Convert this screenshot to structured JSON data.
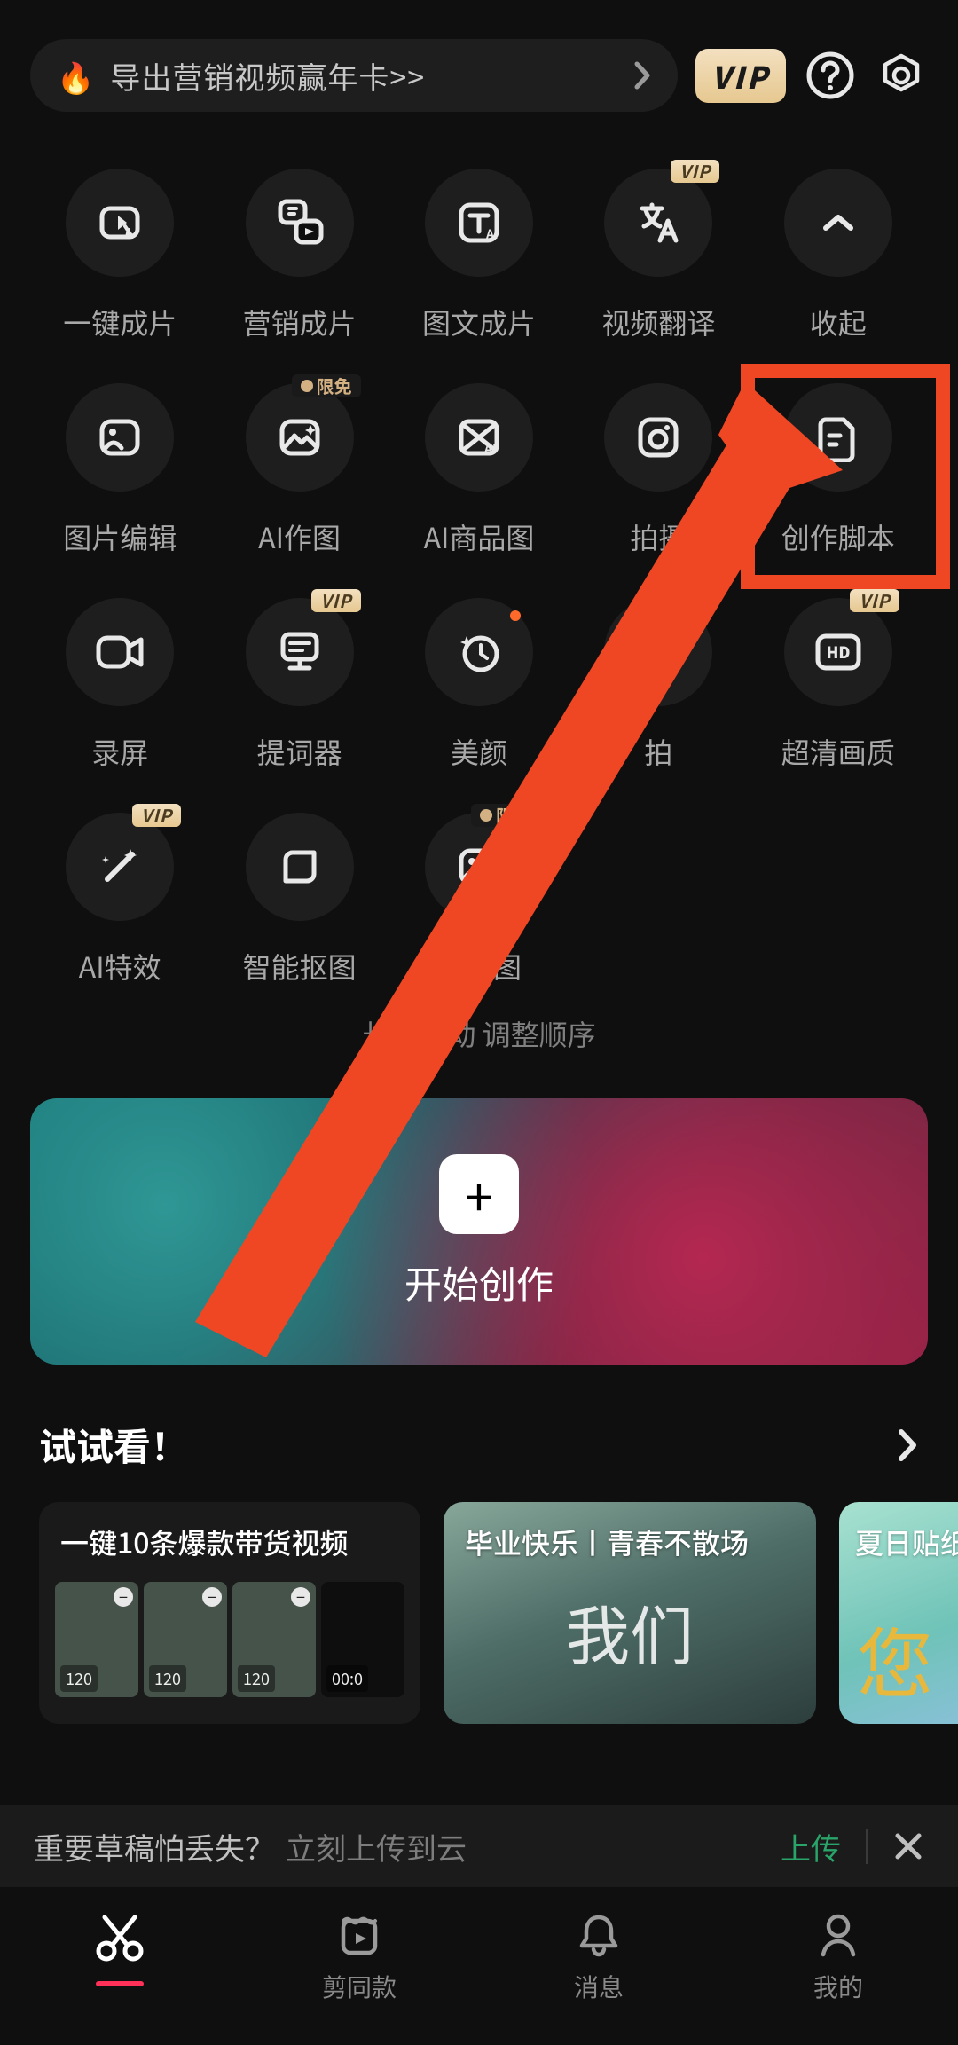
{
  "top": {
    "promo_text": "导出营销视频赢年卡>>",
    "vip_label": "VIP"
  },
  "tags": {
    "vip": "VIP",
    "limited": "限免"
  },
  "grid": {
    "row1": [
      {
        "label": "一键成片"
      },
      {
        "label": "营销成片"
      },
      {
        "label": "图文成片"
      },
      {
        "label": "视频翻译"
      },
      {
        "label": "收起"
      }
    ],
    "row2": [
      {
        "label": "图片编辑"
      },
      {
        "label": "AI作图"
      },
      {
        "label": "AI商品图"
      },
      {
        "label": "拍摄"
      },
      {
        "label": "创作脚本"
      }
    ],
    "row3": [
      {
        "label": "录屏"
      },
      {
        "label": "提词器"
      },
      {
        "label": "美颜"
      },
      {
        "label": "拍"
      },
      {
        "label": "超清画质"
      }
    ],
    "row4": [
      {
        "label": "AI特效"
      },
      {
        "label": "智能抠图"
      },
      {
        "label": "超清图"
      }
    ]
  },
  "hint": "长按拖动    调整顺序",
  "create": {
    "label": "开始创作"
  },
  "try": {
    "title": "试试看！",
    "card1_title": "一键10条爆款带货视频",
    "card1_caps": [
      "120",
      "120",
      "120",
      "00:0"
    ],
    "card2_title": "毕业快乐丨青春不散场",
    "card2_glyph": "我们",
    "card3_title": "夏日贴纸",
    "card3_glyph": "您"
  },
  "cloud": {
    "question": "重要草稿怕丢失？",
    "answer": "立刻上传到云",
    "upload": "上传"
  },
  "nav": {
    "edit": "",
    "same": "剪同款",
    "msg": "消息",
    "mine": "我的"
  }
}
